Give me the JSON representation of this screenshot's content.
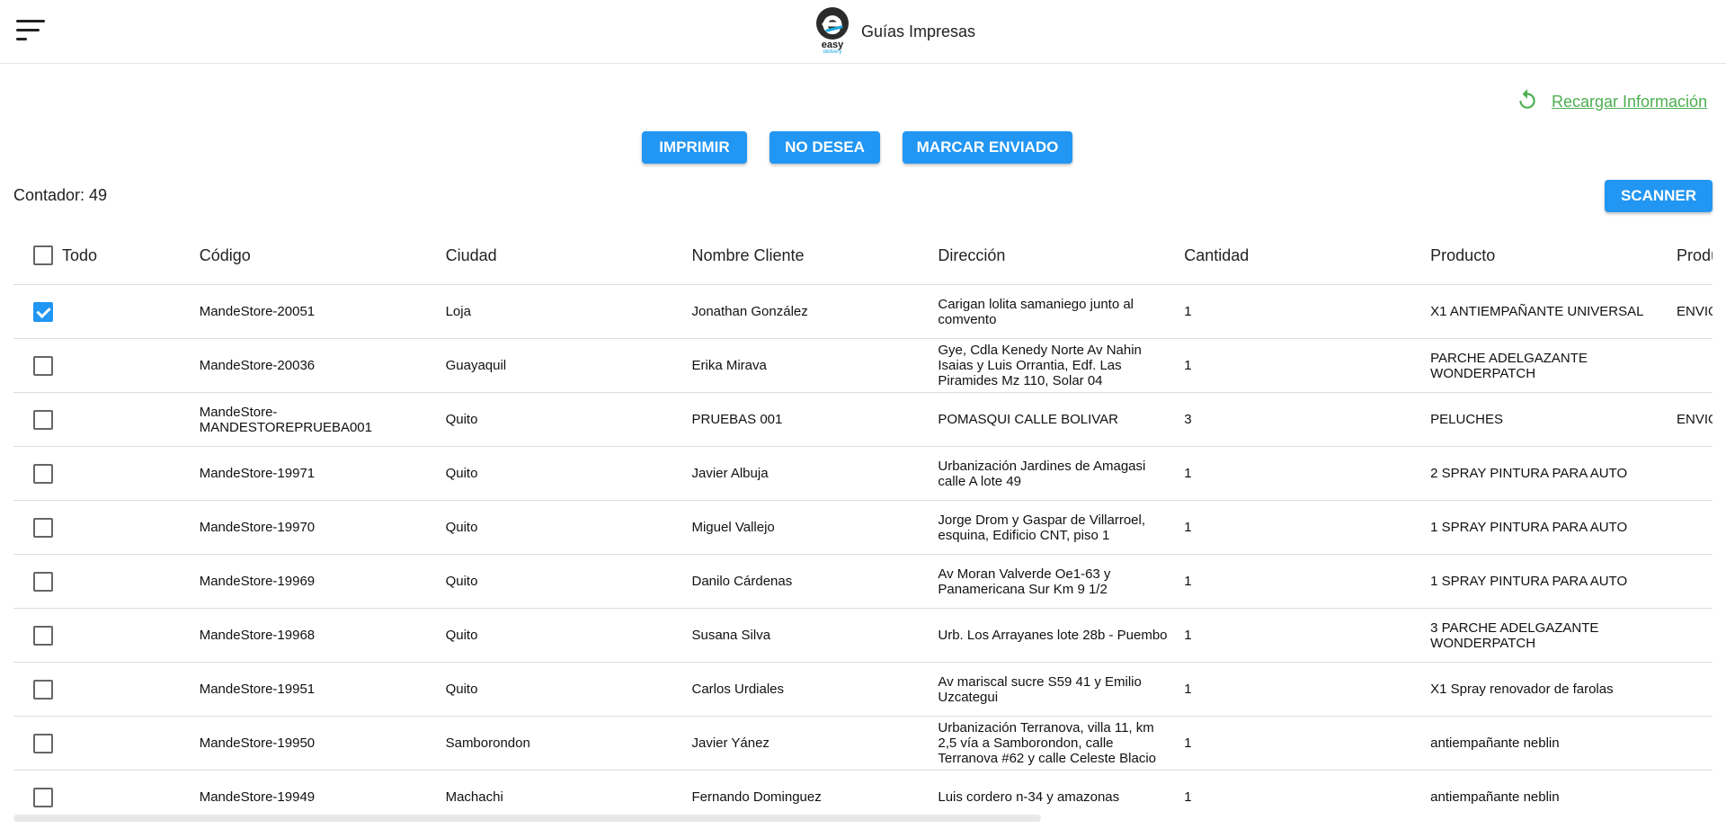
{
  "header": {
    "title": "Guías Impresas",
    "logo_text": "easy",
    "logo_subtext": "delivery"
  },
  "reload": {
    "label": "Recargar Información"
  },
  "actions": {
    "print": "IMPRIMIR",
    "no_desea": "NO DESEA",
    "marcar": "MARCAR ENVIADO",
    "scanner": "SCANNER"
  },
  "counter": {
    "label": "Contador: 49"
  },
  "table": {
    "select_all_label": "Todo",
    "columns": [
      "Código",
      "Ciudad",
      "Nombre Cliente",
      "Dirección",
      "Cantidad",
      "Producto",
      "Producto Extra"
    ],
    "rows": [
      {
        "checked": true,
        "codigo": "MandeStore-20051",
        "ciudad": "Loja",
        "cliente": "Jonathan González",
        "direccion": "Carigan lolita samaniego junto al comvento",
        "cantidad": "1",
        "producto": "X1 ANTIEMPAÑANTE UNIVERSAL",
        "extra": "ENVIO PRIORITARIO"
      },
      {
        "checked": false,
        "codigo": "MandeStore-20036",
        "ciudad": "Guayaquil",
        "cliente": "Erika Mirava",
        "direccion": "Gye, Cdla Kenedy Norte Av Nahin Isaias y Luis Orrantia, Edf. Las Piramides Mz 110, Solar 04",
        "cantidad": "1",
        "producto": "PARCHE ADELGAZANTE WONDERPATCH",
        "extra": ""
      },
      {
        "checked": false,
        "codigo": "MandeStore-MANDESTOREPRUEBA001",
        "ciudad": "Quito",
        "cliente": "PRUEBAS 001",
        "direccion": "POMASQUI CALLE BOLIVAR",
        "cantidad": "3",
        "producto": "PELUCHES",
        "extra": "ENVIO PRORITARIO"
      },
      {
        "checked": false,
        "codigo": "MandeStore-19971",
        "ciudad": "Quito",
        "cliente": "Javier Albuja",
        "direccion": "Urbanización Jardines de Amagasi calle A lote 49",
        "cantidad": "1",
        "producto": "2 SPRAY PINTURA PARA AUTO",
        "extra": ""
      },
      {
        "checked": false,
        "codigo": "MandeStore-19970",
        "ciudad": "Quito",
        "cliente": "Miguel Vallejo",
        "direccion": "Jorge Drom y Gaspar de Villarroel, esquina, Edificio CNT, piso 1",
        "cantidad": "1",
        "producto": "1 SPRAY PINTURA PARA AUTO",
        "extra": ""
      },
      {
        "checked": false,
        "codigo": "MandeStore-19969",
        "ciudad": "Quito",
        "cliente": "Danilo Cárdenas",
        "direccion": "Av Moran Valverde Oe1-63 y Panamericana Sur Km 9 1/2",
        "cantidad": "1",
        "producto": "1 SPRAY PINTURA PARA AUTO",
        "extra": ""
      },
      {
        "checked": false,
        "codigo": "MandeStore-19968",
        "ciudad": "Quito",
        "cliente": "Susana Silva",
        "direccion": "Urb. Los Arrayanes lote 28b - Puembo",
        "cantidad": "1",
        "producto": "3 PARCHE ADELGAZANTE WONDERPATCH",
        "extra": ""
      },
      {
        "checked": false,
        "codigo": "MandeStore-19951",
        "ciudad": "Quito",
        "cliente": "Carlos Urdiales",
        "direccion": "Av mariscal sucre S59 41 y Emilio Uzcategui",
        "cantidad": "1",
        "producto": "X1 Spray renovador de farolas",
        "extra": ""
      },
      {
        "checked": false,
        "codigo": "MandeStore-19950",
        "ciudad": "Samborondon",
        "cliente": "Javier Yánez",
        "direccion": "Urbanización Terranova, villa 11, km 2,5 vía a Samborondon, calle Terranova #62 y calle Celeste Blacio (Referencia atrás de la UEES",
        "cantidad": "1",
        "producto": "antiempañante neblin",
        "extra": ""
      },
      {
        "checked": false,
        "codigo": "MandeStore-19949",
        "ciudad": "Machachi",
        "cliente": "Fernando Dominguez",
        "direccion": "Luis cordero n-34 y amazonas",
        "cantidad": "1",
        "producto": "antiempañante neblin",
        "extra": ""
      }
    ]
  },
  "colors": {
    "primary": "#2196f3",
    "link_green": "#4caf50"
  },
  "icons": {
    "menu": "menu-icon",
    "reload": "refresh-icon",
    "checkbox": "checkbox-icon"
  }
}
